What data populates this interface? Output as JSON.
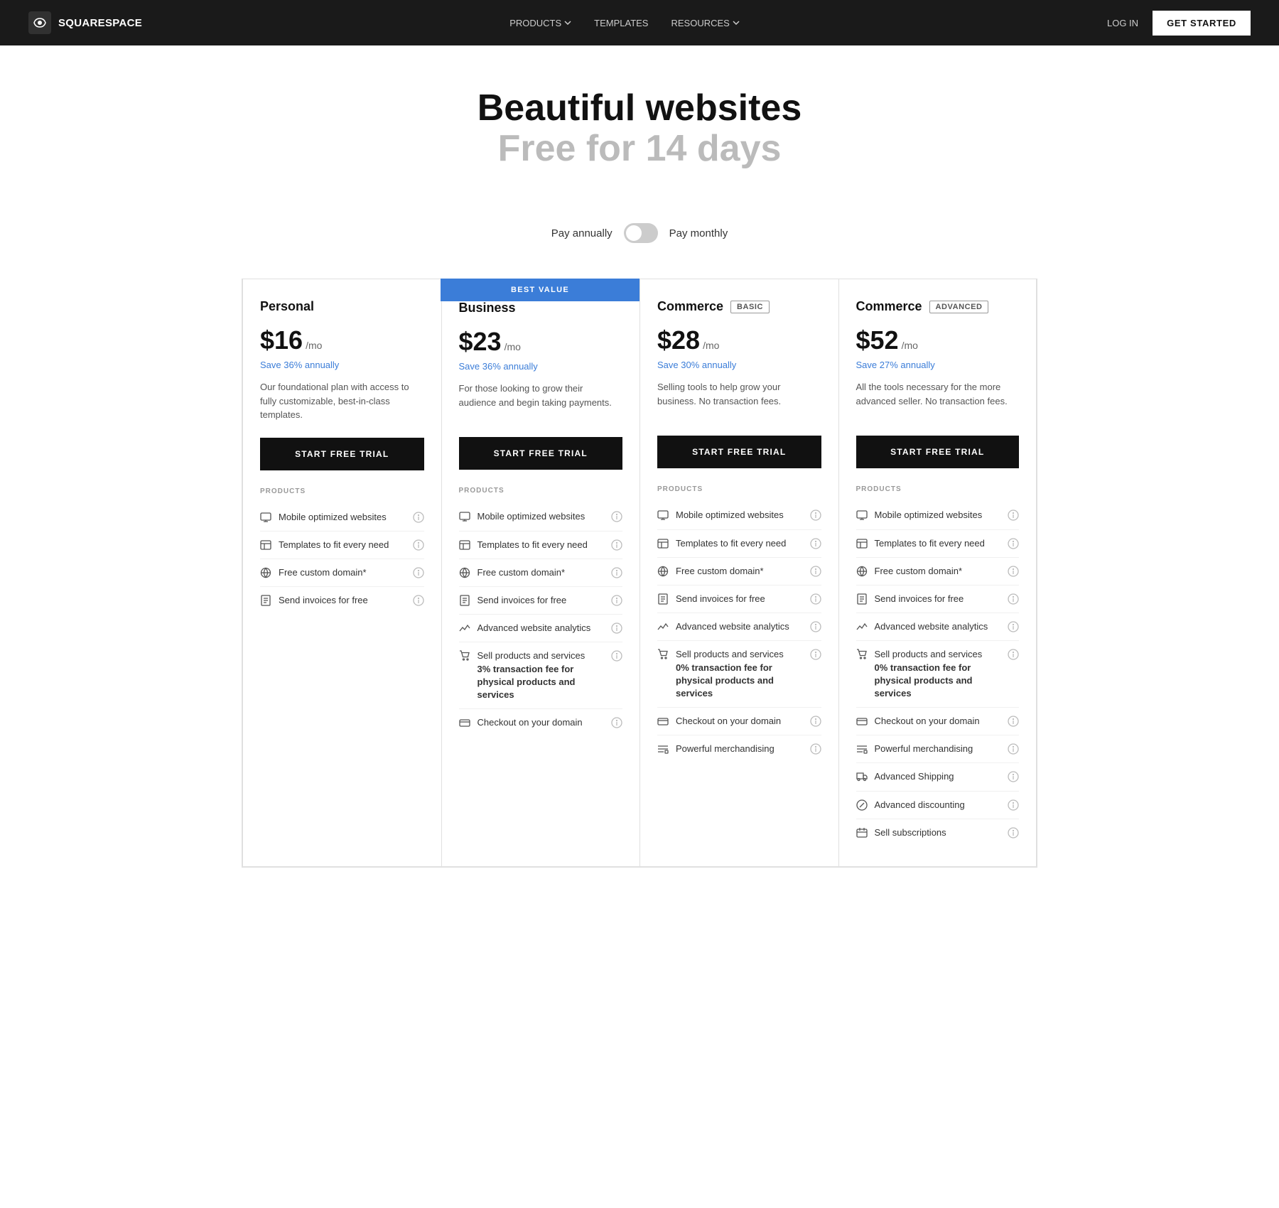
{
  "nav": {
    "logo_text": "SQUARESPACE",
    "links": [
      {
        "label": "PRODUCTS",
        "has_dropdown": true
      },
      {
        "label": "TEMPLATES",
        "has_dropdown": false
      },
      {
        "label": "RESOURCES",
        "has_dropdown": true
      }
    ],
    "login_label": "LOG IN",
    "cta_label": "GET STARTED"
  },
  "hero": {
    "title": "Beautiful websites",
    "subtitle": "Free for 14 days"
  },
  "billing": {
    "annual_label": "Pay annually",
    "monthly_label": "Pay monthly"
  },
  "best_value_label": "BEST VALUE",
  "plans": [
    {
      "id": "personal",
      "name": "Personal",
      "badge": null,
      "price": "$16",
      "period": "/mo",
      "save": "Save 36% annually",
      "desc": "Our foundational plan with access to fully customizable, best-in-class templates.",
      "cta": "START FREE TRIAL",
      "features_label": "PRODUCTS",
      "features": [
        {
          "icon": "monitor",
          "text": "Mobile optimized websites",
          "sub": null
        },
        {
          "icon": "layout",
          "text": "Templates to fit every need",
          "sub": null
        },
        {
          "icon": "globe",
          "text": "Free custom domain*",
          "sub": null
        },
        {
          "icon": "invoice",
          "text": "Send invoices for free",
          "sub": null
        }
      ]
    },
    {
      "id": "business",
      "name": "Business",
      "badge": null,
      "highlighted": true,
      "price": "$23",
      "period": "/mo",
      "save": "Save 36% annually",
      "desc": "For those looking to grow their audience and begin taking payments.",
      "cta": "START FREE TRIAL",
      "features_label": "PRODUCTS",
      "features": [
        {
          "icon": "monitor",
          "text": "Mobile optimized websites",
          "sub": null
        },
        {
          "icon": "layout",
          "text": "Templates to fit every need",
          "sub": null
        },
        {
          "icon": "globe",
          "text": "Free custom domain*",
          "sub": null
        },
        {
          "icon": "invoice",
          "text": "Send invoices for free",
          "sub": null
        },
        {
          "icon": "analytics",
          "text": "Advanced website analytics",
          "sub": null
        },
        {
          "icon": "cart",
          "text": "Sell products and services",
          "sub": "3% transaction fee for physical products and services"
        },
        {
          "icon": "card",
          "text": "Checkout on your domain",
          "sub": null
        }
      ]
    },
    {
      "id": "commerce-basic",
      "name": "Commerce",
      "badge": "BASIC",
      "price": "$28",
      "period": "/mo",
      "save": "Save 30% annually",
      "desc": "Selling tools to help grow your business. No transaction fees.",
      "cta": "START FREE TRIAL",
      "features_label": "PRODUCTS",
      "features": [
        {
          "icon": "monitor",
          "text": "Mobile optimized websites",
          "sub": null
        },
        {
          "icon": "layout",
          "text": "Templates to fit every need",
          "sub": null
        },
        {
          "icon": "globe",
          "text": "Free custom domain*",
          "sub": null
        },
        {
          "icon": "invoice",
          "text": "Send invoices for free",
          "sub": null
        },
        {
          "icon": "analytics",
          "text": "Advanced website analytics",
          "sub": null
        },
        {
          "icon": "cart",
          "text": "Sell products and services",
          "sub": "0% transaction fee for physical products and services"
        },
        {
          "icon": "card",
          "text": "Checkout on your domain",
          "sub": null
        },
        {
          "icon": "list",
          "text": "Powerful merchandising",
          "sub": null
        }
      ]
    },
    {
      "id": "commerce-advanced",
      "name": "Commerce",
      "badge": "ADVANCED",
      "price": "$52",
      "period": "/mo",
      "save": "Save 27% annually",
      "desc": "All the tools necessary for the more advanced seller. No transaction fees.",
      "cta": "START FREE TRIAL",
      "features_label": "PRODUCTS",
      "features": [
        {
          "icon": "monitor",
          "text": "Mobile optimized websites",
          "sub": null
        },
        {
          "icon": "layout",
          "text": "Templates to fit every need",
          "sub": null
        },
        {
          "icon": "globe",
          "text": "Free custom domain*",
          "sub": null
        },
        {
          "icon": "invoice",
          "text": "Send invoices for free",
          "sub": null
        },
        {
          "icon": "analytics",
          "text": "Advanced website analytics",
          "sub": null
        },
        {
          "icon": "cart",
          "text": "Sell products and services",
          "sub": "0% transaction fee for physical products and services"
        },
        {
          "icon": "card",
          "text": "Checkout on your domain",
          "sub": null
        },
        {
          "icon": "list",
          "text": "Powerful merchandising",
          "sub": null
        },
        {
          "icon": "shipping",
          "text": "Advanced Shipping",
          "sub": null
        },
        {
          "icon": "discount",
          "text": "Advanced discounting",
          "sub": null
        },
        {
          "icon": "subscription",
          "text": "Sell subscriptions",
          "sub": null
        }
      ]
    }
  ]
}
